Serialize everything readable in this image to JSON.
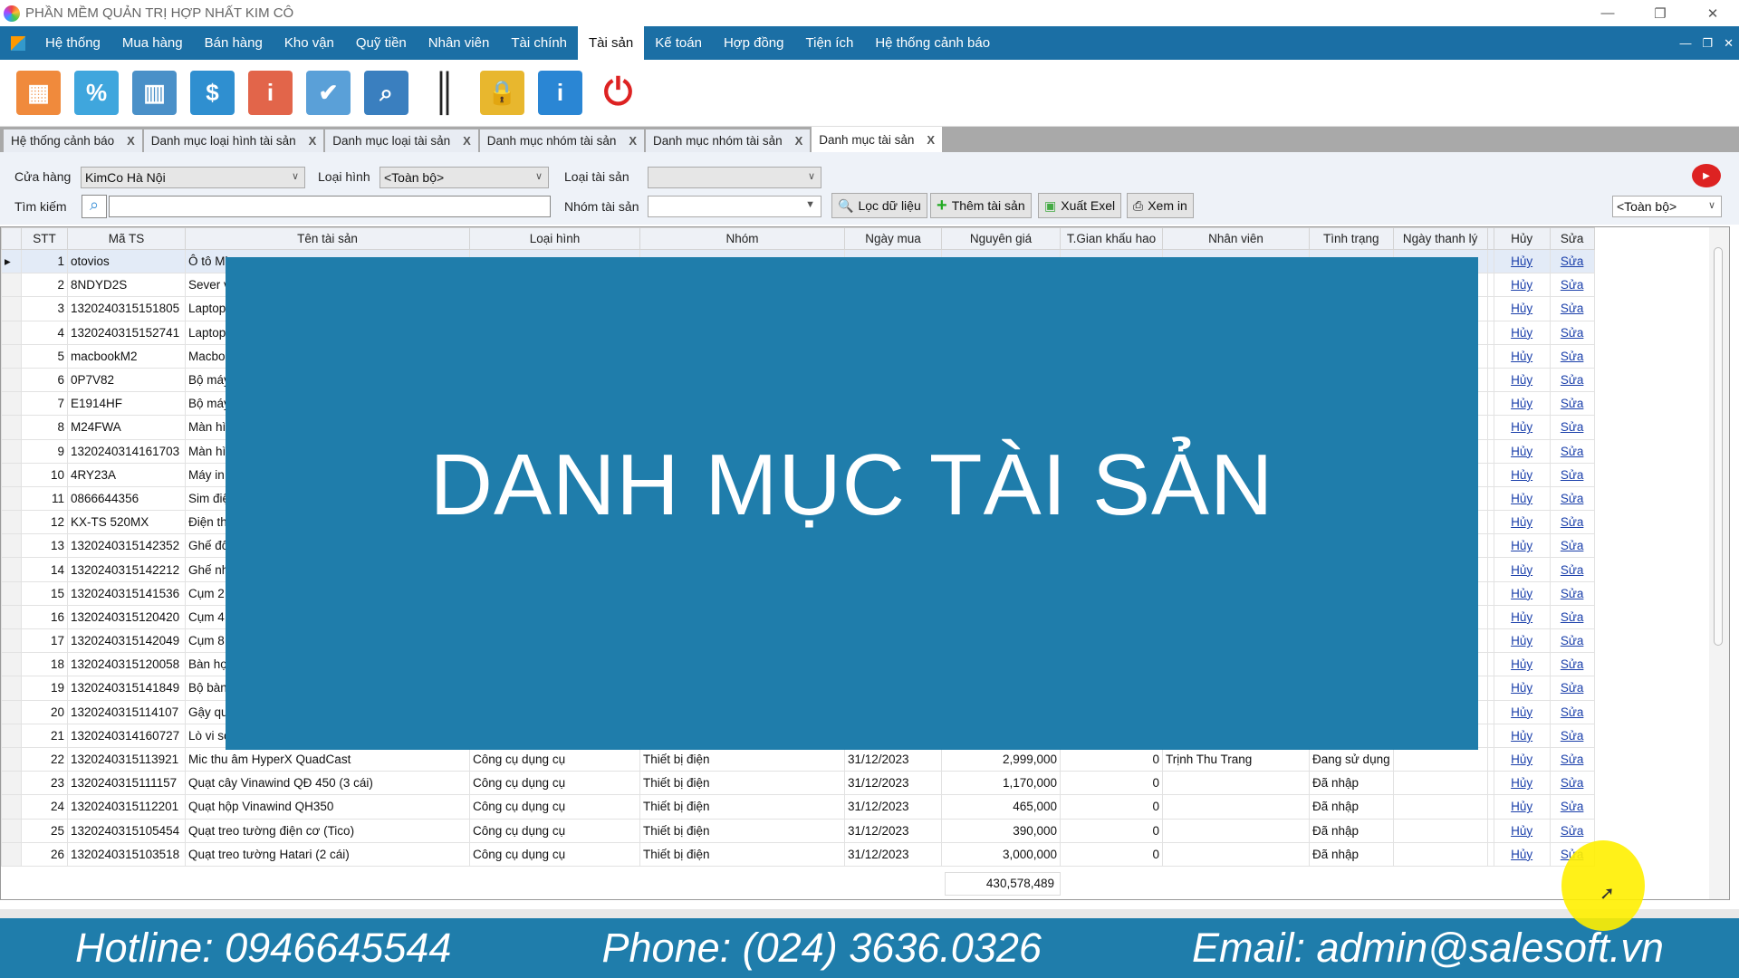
{
  "window": {
    "title": "PHẦN MỀM QUẢN TRỊ HỢP NHẤT KIM CÔ",
    "controls": [
      "—",
      "❐",
      "✕"
    ]
  },
  "menu": {
    "items": [
      "Hệ thống",
      "Mua hàng",
      "Bán hàng",
      "Kho vận",
      "Quỹ tiền",
      "Nhân viên",
      "Tài chính",
      "Tài sản",
      "Kế toán",
      "Hợp đồng",
      "Tiện ích",
      "Hệ thống cảnh báo"
    ],
    "active": "Tài sản",
    "mdi_controls": [
      "—",
      "❐",
      "✕"
    ]
  },
  "toolbar": {
    "icons": [
      {
        "name": "basket-icon",
        "color": "#f08a3c",
        "glyph": "▦"
      },
      {
        "name": "discount-tag-icon",
        "color": "#3fa6dd",
        "glyph": "%"
      },
      {
        "name": "warehouse-icon",
        "color": "#4a90c8",
        "glyph": "▥"
      },
      {
        "name": "money-book-icon",
        "color": "#2f8fd0",
        "glyph": "$"
      },
      {
        "name": "user-info-icon",
        "color": "#e2654a",
        "glyph": "i"
      },
      {
        "name": "checklist-icon",
        "color": "#5aa0d8",
        "glyph": "✔"
      },
      {
        "name": "search-document-icon",
        "color": "#3a7fbf",
        "glyph": "⌕"
      },
      {
        "name": "barcode-icon",
        "color": "#444444",
        "glyph": "║"
      },
      {
        "name": "lock-icon",
        "color": "#e8b72e",
        "glyph": "🔒"
      },
      {
        "name": "info-book-icon",
        "color": "#2a86d4",
        "glyph": "i"
      },
      {
        "name": "power-icon",
        "color": "#ffffff",
        "glyph": "⏻"
      }
    ]
  },
  "tabs": [
    {
      "label": "Hệ thống cảnh báo"
    },
    {
      "label": "Danh mục loại hình tài sản"
    },
    {
      "label": "Danh mục loại tài sản"
    },
    {
      "label": "Danh mục nhóm tài sản"
    },
    {
      "label": "Danh mục nhóm tài sản"
    },
    {
      "label": "Danh mục tài sản",
      "active": true
    }
  ],
  "filters": {
    "store_label": "Cửa hàng",
    "store_value": "KimCo Hà Nội",
    "type_label": "Loại hình",
    "type_value": "<Toàn bộ>",
    "asset_type_label": "Loại tài sản",
    "asset_type_value": "",
    "search_label": "Tìm kiếm",
    "search_value": "",
    "group_label": "Nhóm tài sản",
    "group_value": "",
    "filter_button": "Lọc dữ liệu",
    "add_button": "Thêm tài sản",
    "export_button": "Xuất Exel",
    "print_button": "Xem in",
    "scope_value": "<Toàn bộ>"
  },
  "grid": {
    "columns": [
      "STT",
      "Mã TS",
      "Tên tài sản",
      "Loại hình",
      "Nhóm",
      "Ngày mua",
      "Nguyên giá",
      "T.Gian khấu hao",
      "Nhân viên",
      "Tình trạng",
      "Ngày thanh lý",
      "Hủy",
      "Sửa"
    ],
    "cancel_link": "Hủy",
    "edit_link": "Sửa",
    "rows": [
      [
        "1",
        "otovios",
        "Ô tô Mi",
        "",
        "",
        "",
        "",
        "",
        "",
        "",
        ""
      ],
      [
        "2",
        "8NDYD2S",
        "Sever v",
        "",
        "",
        "",
        "",
        "",
        "",
        "",
        ""
      ],
      [
        "3",
        "1320240315151805",
        "Laptop",
        "",
        "",
        "",
        "",
        "",
        "",
        "",
        ""
      ],
      [
        "4",
        "1320240315152741",
        "Laptop",
        "",
        "",
        "",
        "",
        "",
        "",
        "",
        ""
      ],
      [
        "5",
        "macbookM2",
        "Macboo",
        "",
        "",
        "",
        "",
        "",
        "",
        "",
        ""
      ],
      [
        "6",
        "0P7V82",
        "Bộ máy",
        "",
        "",
        "",
        "",
        "",
        "",
        "",
        ""
      ],
      [
        "7",
        "E1914HF",
        "Bộ máy",
        "",
        "",
        "",
        "",
        "",
        "",
        "",
        ""
      ],
      [
        "8",
        "M24FWA",
        "Màn hìn",
        "",
        "",
        "",
        "",
        "",
        "",
        "",
        ""
      ],
      [
        "9",
        "1320240314161703",
        "Màn hìn",
        "",
        "",
        "",
        "",
        "",
        "",
        "",
        ""
      ],
      [
        "10",
        "4RY23A",
        "Máy in",
        "",
        "",
        "",
        "",
        "",
        "",
        "",
        ""
      ],
      [
        "11",
        "0866644356",
        "Sim điệ",
        "",
        "",
        "",
        "",
        "",
        "",
        "",
        ""
      ],
      [
        "12",
        "KX-TS 520MX",
        "Điện th",
        "",
        "",
        "",
        "",
        "",
        "",
        "",
        ""
      ],
      [
        "13",
        "1320240315142352",
        "Ghế đô",
        "",
        "",
        "",
        "",
        "",
        "",
        "",
        ""
      ],
      [
        "14",
        "1320240315142212",
        "Ghế nh",
        "",
        "",
        "",
        "",
        "",
        "",
        "",
        ""
      ],
      [
        "15",
        "1320240315141536",
        "Cụm 2",
        "",
        "",
        "",
        "",
        "",
        "",
        "",
        ""
      ],
      [
        "16",
        "1320240315120420",
        "Cụm 4",
        "",
        "",
        "",
        "",
        "",
        "",
        "",
        ""
      ],
      [
        "17",
        "1320240315142049",
        "Cụm 8",
        "",
        "",
        "",
        "",
        "",
        "",
        "",
        ""
      ],
      [
        "18",
        "1320240315120058",
        "Bàn họ",
        "",
        "",
        "",
        "",
        "",
        "",
        "",
        ""
      ],
      [
        "19",
        "1320240315141849",
        "Bộ bàn",
        "",
        "",
        "",
        "",
        "",
        "",
        "",
        ""
      ],
      [
        "20",
        "1320240315114107",
        "Gậy qu",
        "",
        "",
        "",
        "",
        "",
        "",
        "",
        ""
      ],
      [
        "21",
        "1320240314160727",
        "Lò vi só",
        "",
        "",
        "",
        "",
        "",
        "",
        "",
        ""
      ],
      [
        "22",
        "1320240315113921",
        "Mic thu âm HyperX QuadCast",
        "Công cụ dụng cụ",
        "Thiết bị điện",
        "31/12/2023",
        "2,999,000",
        "0",
        "Trịnh Thu Trang",
        "Đang sử dụng",
        ""
      ],
      [
        "23",
        "1320240315111157",
        "Quạt cây Vinawind QĐ 450 (3 cái)",
        "Công cụ dụng cụ",
        "Thiết bị điện",
        "31/12/2023",
        "1,170,000",
        "0",
        "",
        "Đã nhập",
        ""
      ],
      [
        "24",
        "1320240315112201",
        "Quạt hộp Vinawind QH350",
        "Công cụ dụng cụ",
        "Thiết bị điện",
        "31/12/2023",
        "465,000",
        "0",
        "",
        "Đã nhập",
        ""
      ],
      [
        "25",
        "1320240315105454",
        "Quạt treo tường điện cơ (Tico)",
        "Công cụ dụng cụ",
        "Thiết bị điện",
        "31/12/2023",
        "390,000",
        "0",
        "",
        "Đã nhập",
        ""
      ],
      [
        "26",
        "1320240315103518",
        "Quạt treo tường Hatari (2 cái)",
        "Công cụ dụng cụ",
        "Thiết bị điện",
        "31/12/2023",
        "3,000,000",
        "0",
        "",
        "Đã nhập",
        ""
      ]
    ],
    "total_cost": "430,578,489"
  },
  "overlay": {
    "title": "DANH MỤC TÀI SẢN",
    "color": "#1f7dab"
  },
  "footer": {
    "hotline": "Hotline: 0946645544",
    "phone": "Phone: (024) 3636.0326",
    "email": "Email: admin@salesoft.vn"
  }
}
